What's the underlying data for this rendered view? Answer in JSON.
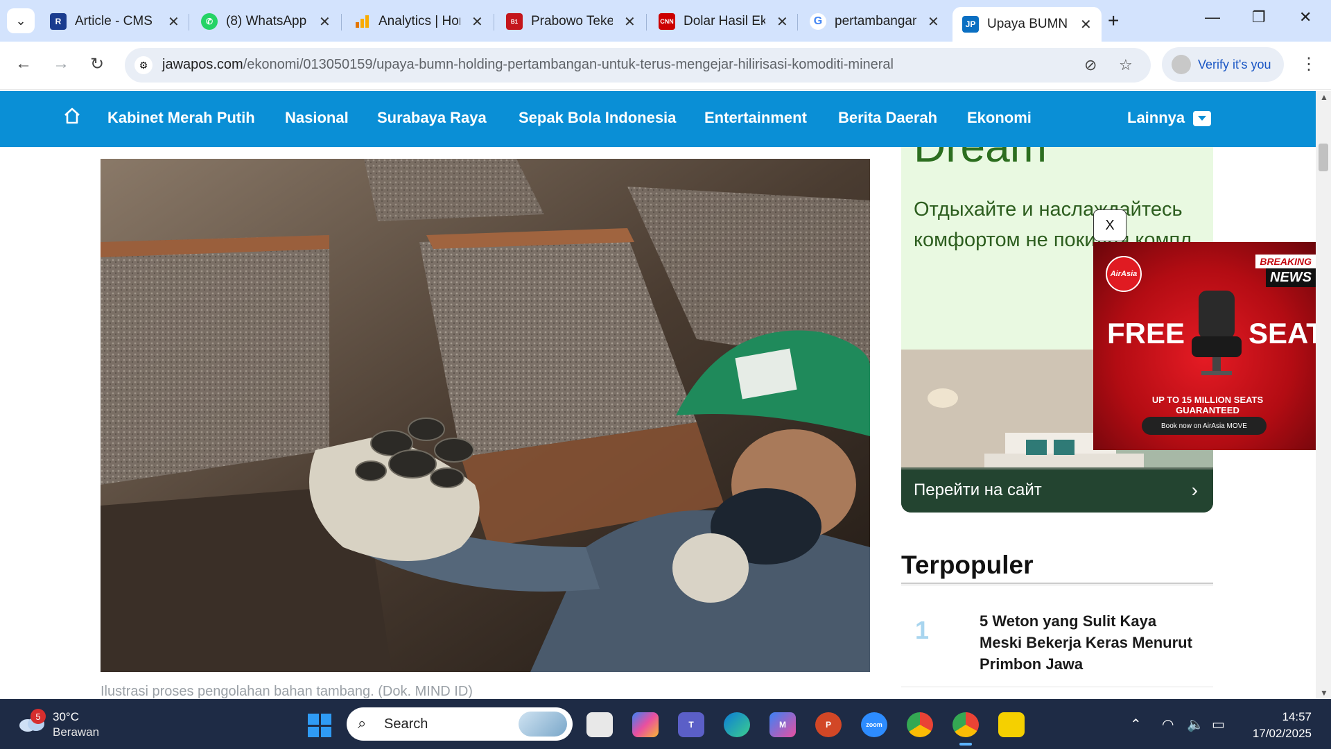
{
  "browser": {
    "tabs": [
      {
        "title": "Article - CMS",
        "favicon": "cms-logo",
        "color": "#1a3c8f"
      },
      {
        "title": "(8) WhatsApp",
        "favicon": "whatsapp-logo",
        "color": "#25d366"
      },
      {
        "title": "Analytics | Hom",
        "favicon": "analytics-logo",
        "color": "#f9ab00"
      },
      {
        "title": "Prabowo Teke",
        "favicon": "beritasatu-logo",
        "color": "#c4161c"
      },
      {
        "title": "Dolar Hasil Ek",
        "favicon": "cnn-logo",
        "color": "#cc0000"
      },
      {
        "title": "pertambangan",
        "favicon": "google-logo",
        "color": "#4285f4"
      },
      {
        "title": "Upaya BUMN",
        "favicon": "jawapos-logo",
        "color": "#0a6fc2",
        "active": true
      }
    ],
    "address": {
      "domain": "jawapos.com",
      "path": "/ekonomi/013050159/upaya-bumn-holding-pertambangan-untuk-terus-mengejar-hilirisasi-komoditi-mineral"
    },
    "verify_label": "Verify it's you"
  },
  "site_nav": {
    "items": [
      "Kabinet Merah Putih",
      "Nasional",
      "Surabaya Raya",
      "Sepak Bola Indonesia",
      "Entertainment",
      "Berita Daerah",
      "Ekonomi"
    ],
    "more": "Lainnya",
    "color": "#0a8fd6"
  },
  "article": {
    "caption": "Ilustrasi proses pengolahan bahan tambang. (Dok. MIND ID)"
  },
  "sidebar_ad": {
    "heading": "Dream",
    "text": "Отдыхайте и наслаждайтесь комфортом не покидая компл",
    "cta": "Перейти на сайт"
  },
  "popup_ad": {
    "close": "X",
    "brand": "AirAsia",
    "breaking": "BREAKING",
    "news": "NEWS",
    "free": "FREE",
    "seat": "SEAT",
    "guarantee": "UP TO 15 MILLION SEATS GUARANTEED",
    "book": "Book now on AirAsia MOVE"
  },
  "popular": {
    "title": "Terpopuler",
    "items": [
      {
        "rank": "1",
        "title": "5 Weton yang Sulit Kaya Meski Bekerja Keras Menurut Primbon Jawa"
      }
    ]
  },
  "taskbar": {
    "weather": {
      "temp": "30°C",
      "condition": "Berawan",
      "badge": "5"
    },
    "search_label": "Search",
    "time": "14:57",
    "date": "17/02/2025"
  }
}
